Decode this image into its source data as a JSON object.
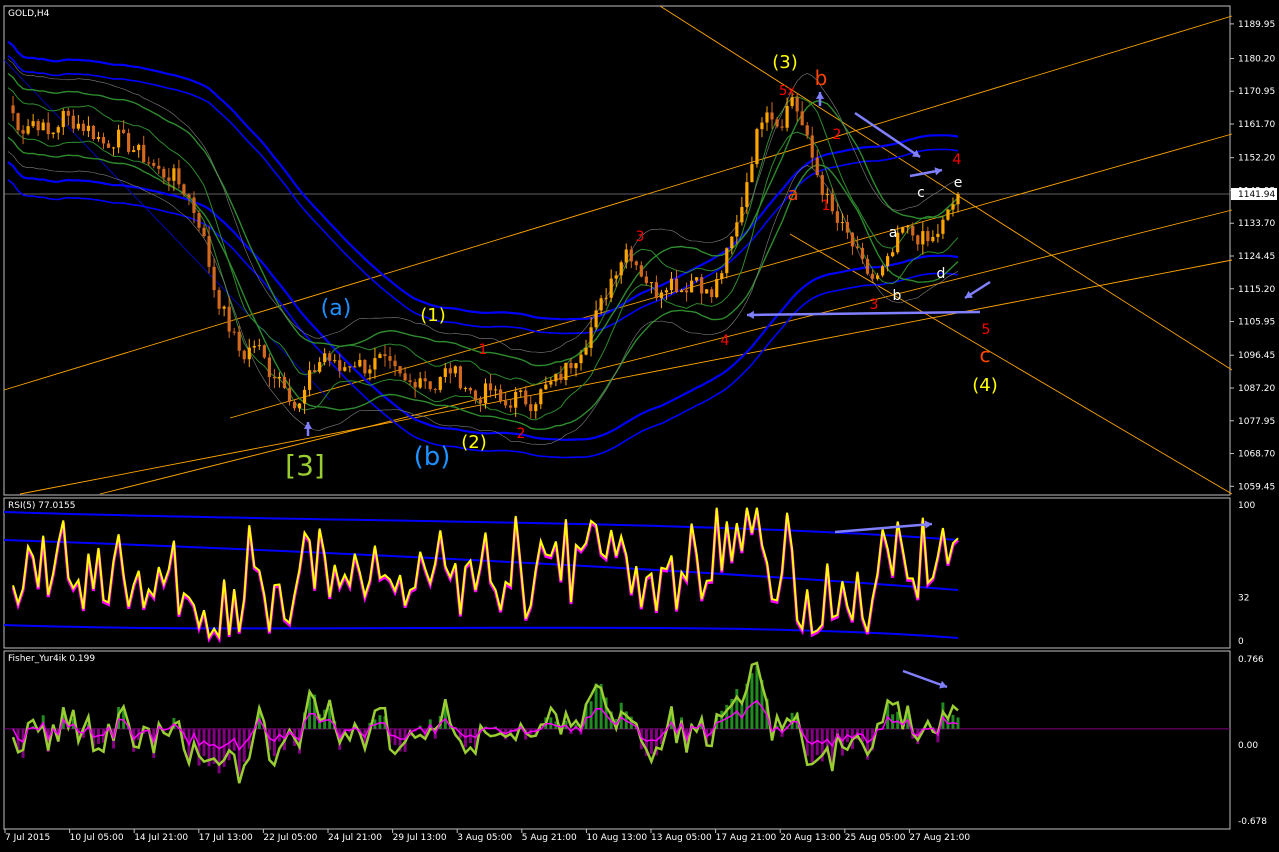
{
  "window": {
    "symbol_label": "GOLD,H4"
  },
  "chart_data": [
    {
      "type": "candlestick",
      "title": "GOLD,H4",
      "ylim": [
        1057,
        1195
      ],
      "y_ticks": [
        "1189.95",
        "1180.20",
        "1170.95",
        "1161.70",
        "1152.20",
        "1143.95",
        "1133.70",
        "1124.45",
        "1115.20",
        "1105.95",
        "1096.45",
        "1087.20",
        "1077.95",
        "1068.70",
        "1059.45"
      ],
      "y_tick_values": [
        1189.95,
        1180.2,
        1170.95,
        1161.7,
        1152.2,
        1142.95,
        1133.7,
        1124.45,
        1115.2,
        1105.95,
        1096.45,
        1087.2,
        1077.95,
        1068.7,
        1059.45
      ],
      "current_price": "1141.94",
      "current_price_value": 1141.94,
      "x_labels": [
        "7 Jul 2015",
        "10 Jul 05:00",
        "14 Jul 21:00",
        "17 Jul 13:00",
        "22 Jul 05:00",
        "24 Jul 21:00",
        "29 Jul 13:00",
        "3 Aug 05:00",
        "5 Aug 21:00",
        "10 Aug 13:00",
        "13 Aug 05:00",
        "17 Aug 21:00",
        "20 Aug 13:00",
        "25 Aug 05:00",
        "27 Aug 21:00"
      ],
      "close_path": [
        1167,
        1160,
        1163,
        1158,
        1164,
        1162,
        1160,
        1156,
        1158,
        1155,
        1152,
        1148,
        1147,
        1142,
        1133,
        1115,
        1105,
        1096,
        1100,
        1092,
        1090,
        1080,
        1091,
        1097,
        1092,
        1095,
        1093,
        1095,
        1092,
        1088,
        1091,
        1087,
        1093,
        1089,
        1084,
        1087,
        1082,
        1085,
        1083,
        1087,
        1090,
        1095,
        1101,
        1110,
        1120,
        1127,
        1120,
        1114,
        1118,
        1115,
        1119,
        1112,
        1122,
        1134,
        1152,
        1168,
        1161,
        1170,
        1157,
        1145,
        1135,
        1130,
        1122,
        1117,
        1123,
        1132,
        1130,
        1128,
        1134,
        1141.94
      ],
      "wave_labels": [
        "[3]",
        "(a)",
        "(b)",
        "(1)",
        "(2)",
        "1",
        "2",
        "3",
        "4",
        "(3)",
        "5x",
        "b",
        "a",
        "2",
        "1",
        "3",
        "4",
        "c",
        "e",
        "a",
        "d",
        "b",
        "5",
        "c",
        "(4)"
      ]
    },
    {
      "type": "line",
      "title": "RSI(5) 77.0155",
      "ylim": [
        0,
        100
      ],
      "y_ticks": [
        "100",
        "32",
        "0"
      ],
      "y_tick_values": [
        100,
        32,
        0
      ],
      "series": [
        {
          "name": "RSI(5)",
          "last": 77.0155
        }
      ]
    },
    {
      "type": "histogram",
      "title": "Fisher_Yur4ik 0.199",
      "ylim": [
        -0.678,
        0.766
      ],
      "y_ticks": [
        "0.766",
        "0.00",
        "-0.678"
      ],
      "y_tick_values": [
        0.766,
        0.0,
        -0.678
      ],
      "series": [
        {
          "name": "Fisher_Yur4ik",
          "last": 0.199
        }
      ]
    }
  ],
  "colors": {
    "bull": "#ffa500",
    "bear": "#d2691e",
    "wave_yellow": "#ffff00",
    "wave_red": "#ff0000",
    "wave_cyan": "#1e90ff",
    "wave_green": "#9acd32",
    "channel": "#ffa500",
    "band_blue": "#0000ff",
    "band_green": "#2e8b2e",
    "rsi": "#ffff00",
    "fisher_line": "#9acd32",
    "fisher_signal": "#ff00ff",
    "arrow": "#8080ff"
  }
}
